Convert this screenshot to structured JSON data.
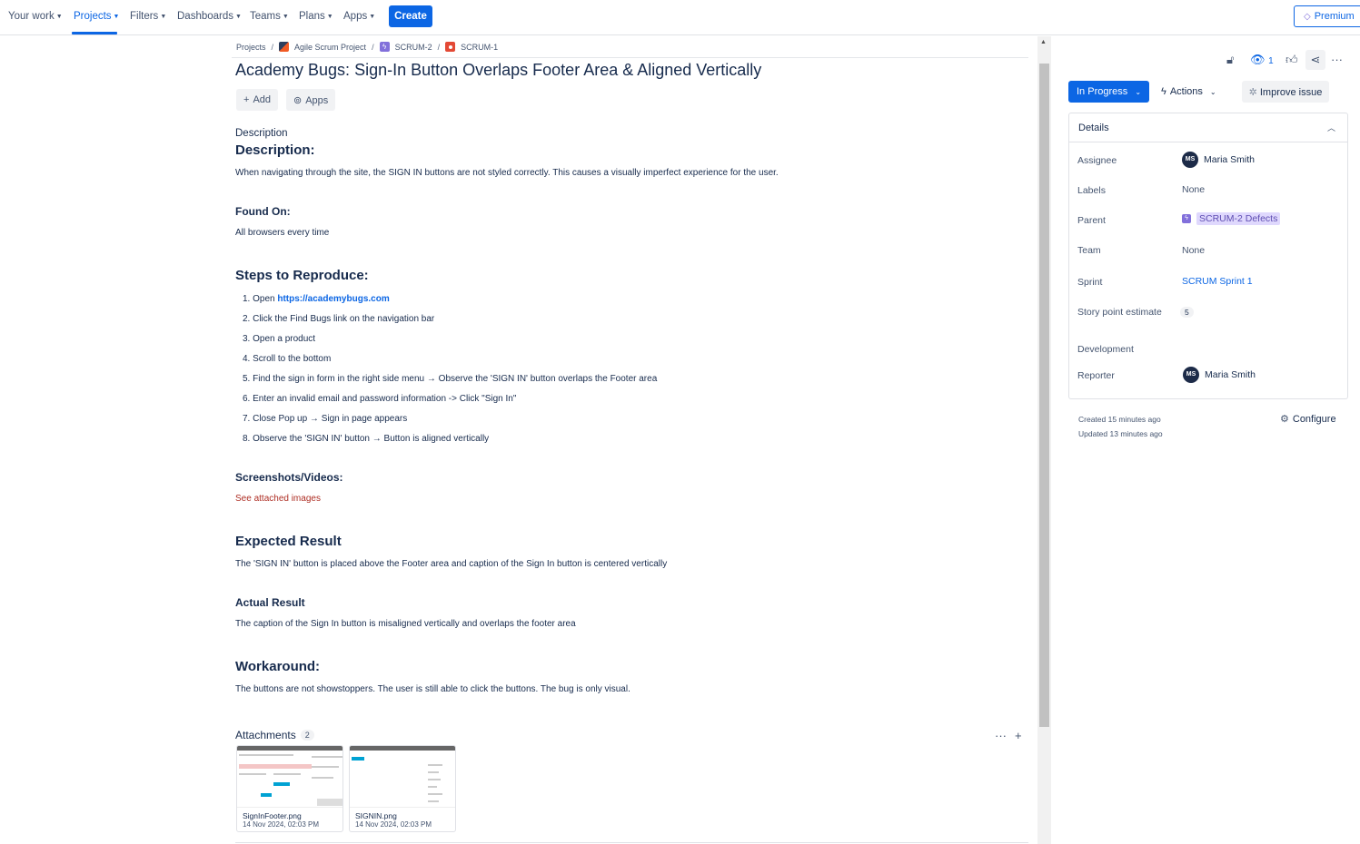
{
  "nav": {
    "items": [
      {
        "label": "Your work"
      },
      {
        "label": "Projects"
      },
      {
        "label": "Filters"
      },
      {
        "label": "Dashboards"
      },
      {
        "label": "Teams"
      },
      {
        "label": "Plans"
      },
      {
        "label": "Apps"
      }
    ],
    "create_label": "Create",
    "premium_label": "Premium"
  },
  "breadcrumb": {
    "projects": "Projects",
    "project": "Agile Scrum Project",
    "parent": "SCRUM-2",
    "issue": "SCRUM-1"
  },
  "issue": {
    "title": "Academy Bugs: Sign-In Button Overlaps Footer Area & Aligned Vertically",
    "add_label": "Add",
    "apps_label": "Apps"
  },
  "description": {
    "field_label": "Description",
    "heading": "Description:",
    "text": "When navigating through the site, the SIGN IN buttons are not styled correctly. This causes a visually imperfect experience for the user.",
    "found_on_heading": "Found On:",
    "found_on_text": "All browsers every time",
    "steps_heading": "Steps to Reproduce:",
    "step1_prefix": "1. Open ",
    "step1_link": "https://academybugs.com",
    "steps": [
      "2. Click the Find Bugs link on the navigation bar",
      "3. Open a product",
      "4. Scroll to the bottom",
      "5. Find the sign in form in the right side menu → Observe the 'SIGN IN' button overlaps the Footer area",
      "6. Enter an invalid email and password information  -> Click \"Sign In\"",
      "7.  Close Pop up → Sign in page appears",
      "8. Observe the 'SIGN IN' button → Button is aligned vertically"
    ],
    "screenshots_heading": "Screenshots/Videos:",
    "screenshots_text": "See attached images",
    "expected_heading": "Expected Result",
    "expected_text": "The 'SIGN IN' button is placed above the Footer area and caption of the Sign In button is centered vertically",
    "actual_heading": "Actual Result",
    "actual_text": "The caption of the Sign In button is misaligned vertically and overlaps the footer area",
    "workaround_heading": "Workaround:",
    "workaround_text": "The buttons are not showstoppers. The user is still able to click the buttons. The bug is only visual."
  },
  "attachments": {
    "heading": "Attachments",
    "count": "2",
    "files": [
      {
        "name": "SignInFooter.png",
        "date": "14 Nov 2024, 02:03 PM"
      },
      {
        "name": "SIGNIN.png",
        "date": "14 Nov 2024, 02:03 PM"
      }
    ]
  },
  "sidebar": {
    "watch_count": "1",
    "status_label": "In Progress",
    "actions_label": "Actions",
    "improve_label": "Improve issue",
    "details_heading": "Details",
    "fields": {
      "assignee_label": "Assignee",
      "assignee_initials": "MS",
      "assignee_name": "Maria Smith",
      "labels_label": "Labels",
      "labels_value": "None",
      "parent_label": "Parent",
      "parent_value": "SCRUM-2 Defects",
      "team_label": "Team",
      "team_value": "None",
      "sprint_label": "Sprint",
      "sprint_value": "SCRUM Sprint 1",
      "story_points_label": "Story point estimate",
      "story_points_value": "5",
      "development_label": "Development",
      "reporter_label": "Reporter",
      "reporter_initials": "MS",
      "reporter_name": "Maria Smith"
    },
    "created": "Created 15 minutes ago",
    "updated": "Updated 13 minutes ago",
    "configure_label": "Configure"
  },
  "colors": {
    "brand_blue": "#0c66e4",
    "epic_purple": "#8270db",
    "bug_red": "#e34935",
    "link_red": "#ae2e24"
  }
}
